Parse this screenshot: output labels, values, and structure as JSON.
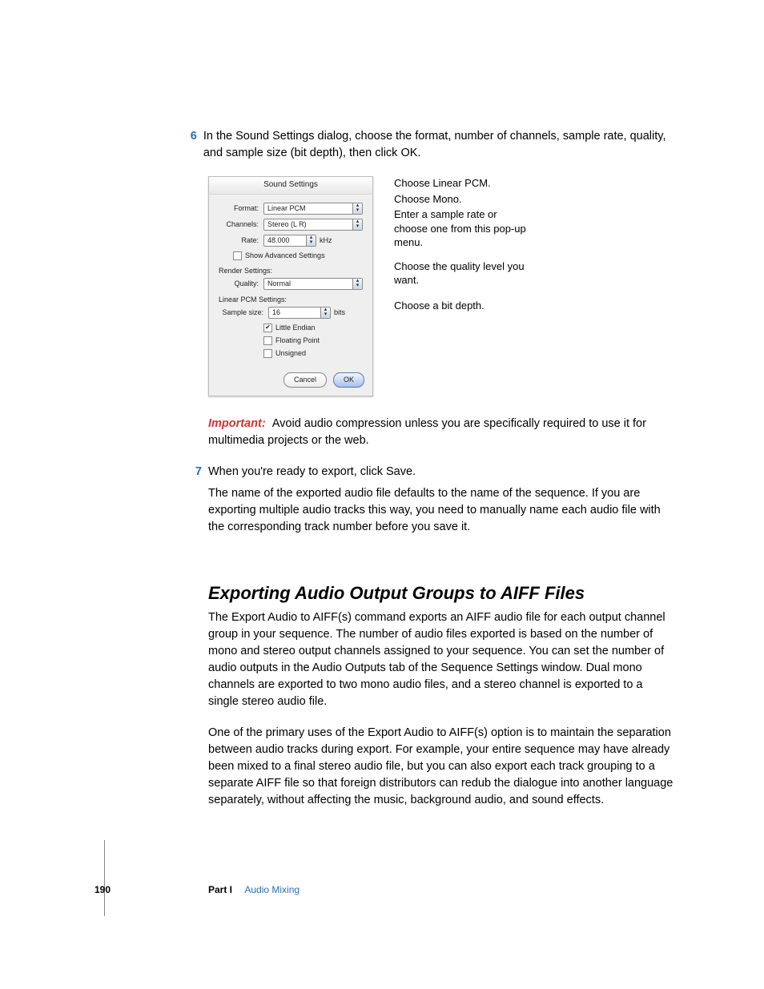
{
  "step6": {
    "num": "6",
    "text": "In the Sound Settings dialog, choose the format, number of channels, sample rate, quality, and sample size (bit depth), then click OK."
  },
  "dialog": {
    "title": "Sound Settings",
    "format_label": "Format:",
    "format_value": "Linear PCM",
    "channels_label": "Channels:",
    "channels_value": "Stereo (L R)",
    "rate_label": "Rate:",
    "rate_value": "48.000",
    "rate_unit": "kHz",
    "show_advanced": "Show Advanced Settings",
    "render_heading": "Render Settings:",
    "quality_label": "Quality:",
    "quality_value": "Normal",
    "pcm_heading": "Linear PCM Settings:",
    "sample_size_label": "Sample size:",
    "sample_size_value": "16",
    "sample_size_unit": "bits",
    "little_endian": "Little Endian",
    "floating_point": "Floating Point",
    "unsigned": "Unsigned",
    "cancel": "Cancel",
    "ok": "OK"
  },
  "annotations": {
    "a1": "Choose Linear PCM.",
    "a2": "Choose Mono.",
    "a3": "Enter a sample rate or choose one from this pop-up menu.",
    "a4": "Choose the quality level you want.",
    "a5": "Choose a bit depth."
  },
  "important": {
    "label": "Important:",
    "text": "Avoid audio compression unless you are specifically required to use it for multimedia projects or the web."
  },
  "step7": {
    "num": "7",
    "text": "When you're ready to export, click Save."
  },
  "step7_followup": "The name of the exported audio file defaults to the name of the sequence. If you are exporting multiple audio tracks this way, you need to manually name each audio file with the corresponding track number before you save it.",
  "heading": "Exporting Audio Output Groups to AIFF Files",
  "para1": "The Export Audio to AIFF(s) command exports an AIFF audio file for each output channel group in your sequence. The number of audio files exported is based on the number of mono and stereo output channels assigned to your sequence. You can set the number of audio outputs in the Audio Outputs tab of the Sequence Settings window. Dual mono channels are exported to two mono audio files, and a stereo channel is exported to a single stereo audio file.",
  "para2": "One of the primary uses of the Export Audio to AIFF(s) option is to maintain the separation between audio tracks during export. For example, your entire sequence may have already been mixed to a final stereo audio file, but you can also export each track grouping to a separate AIFF file so that foreign distributors can redub the dialogue into another language separately, without affecting the music, background audio, and sound effects.",
  "footer": {
    "page": "190",
    "part": "Part I",
    "label": "Audio Mixing"
  }
}
